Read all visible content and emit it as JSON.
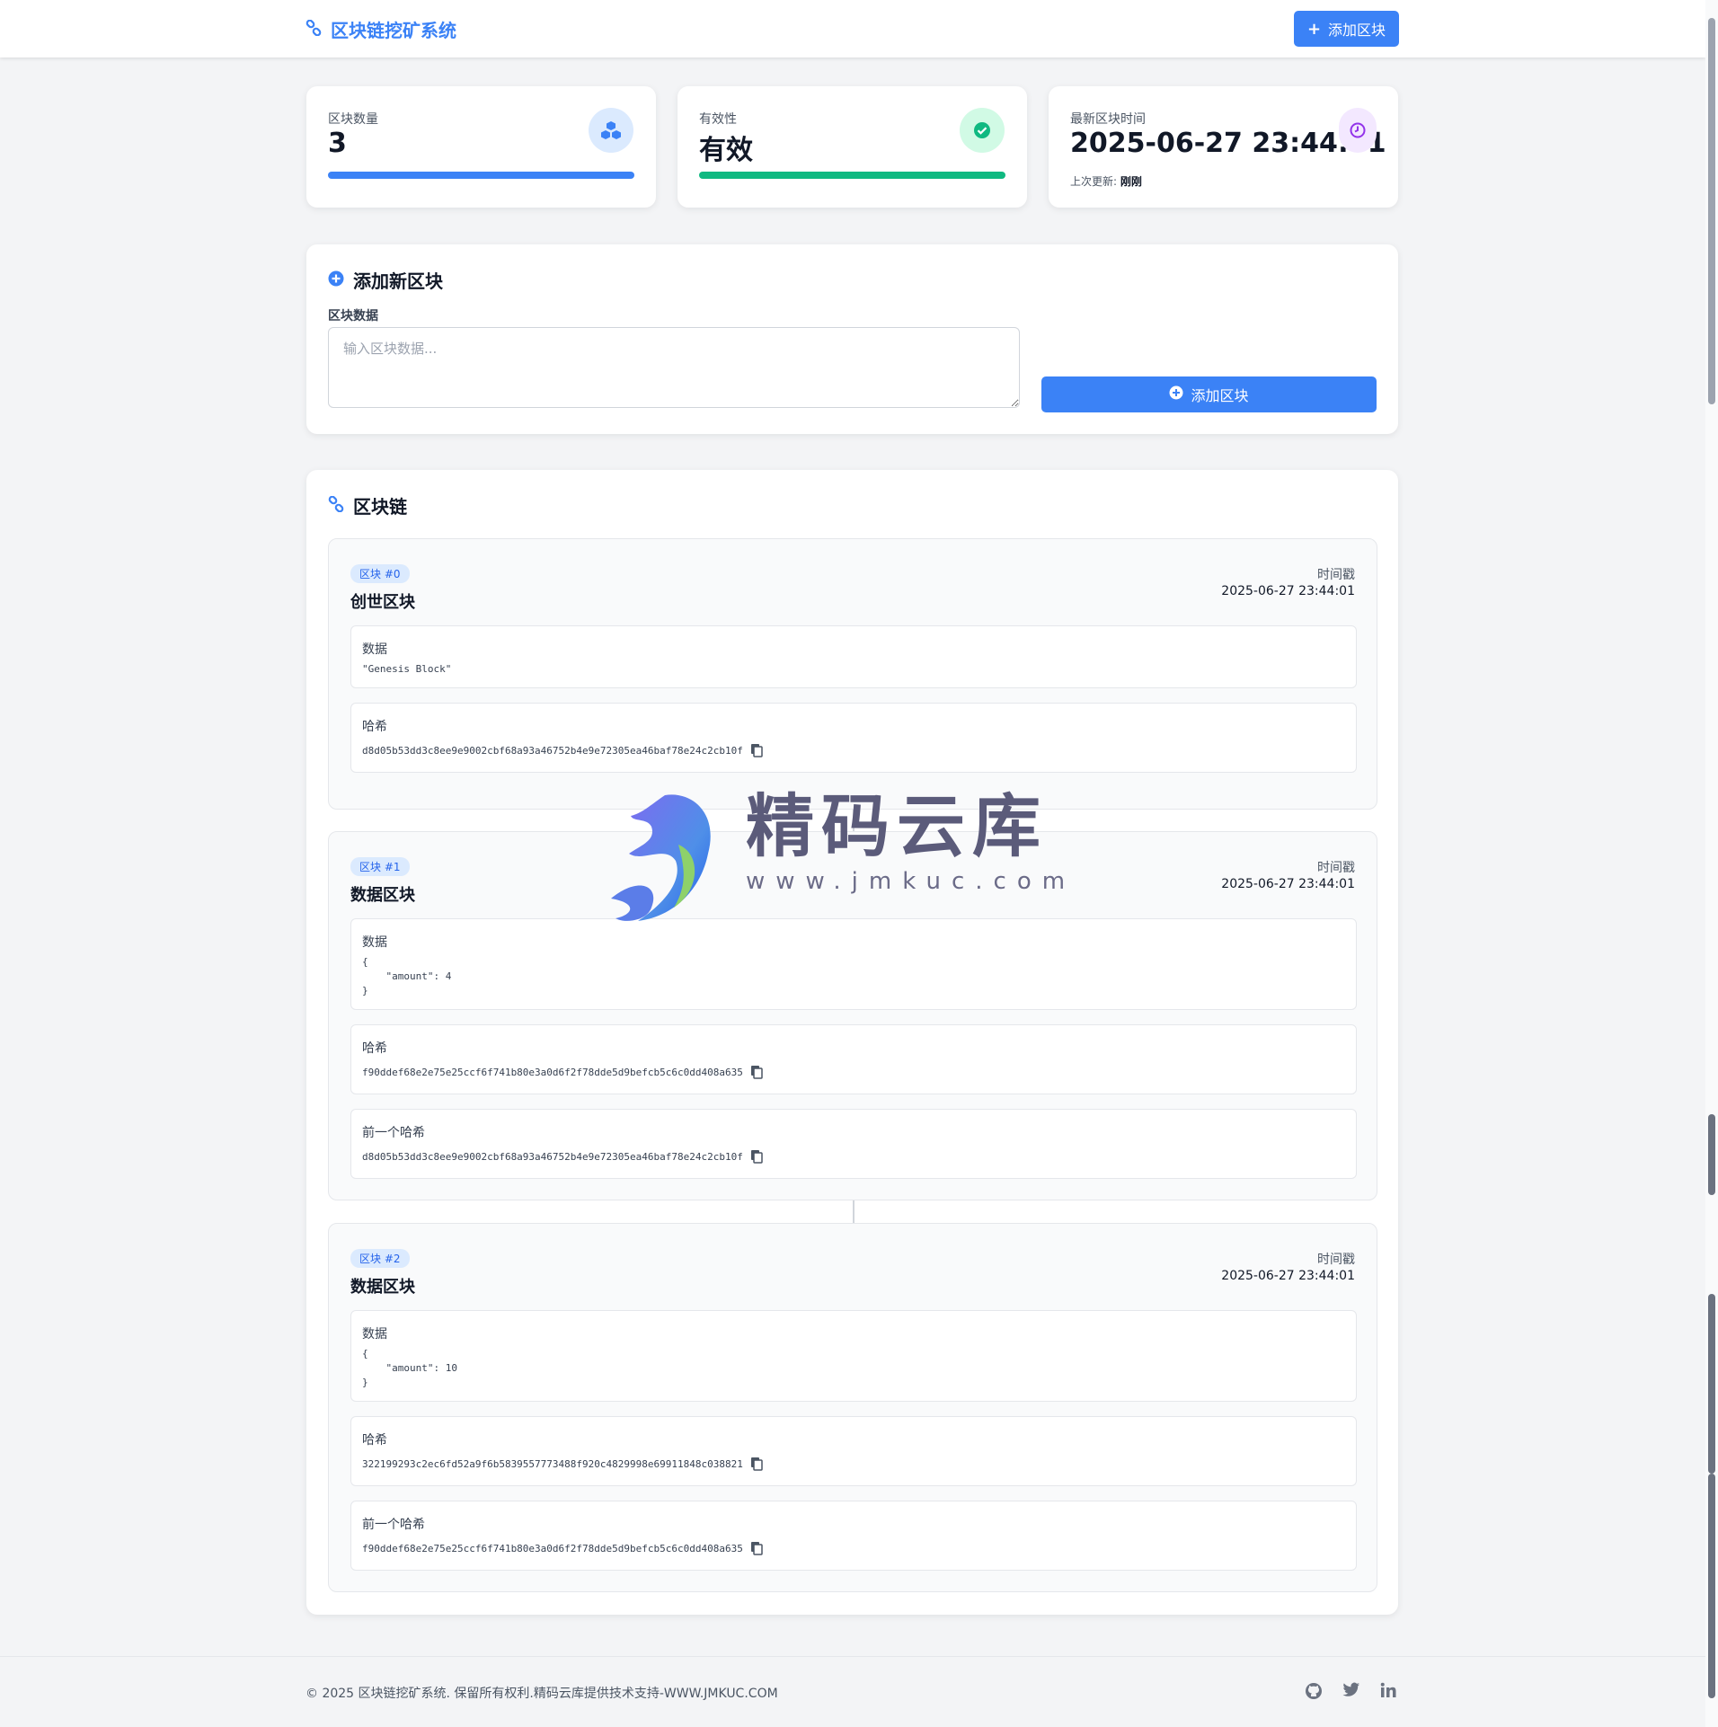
{
  "header": {
    "brand": "区块链挖矿系统",
    "add_button": "添加区块"
  },
  "stats": {
    "count_label": "区块数量",
    "count_value": "3",
    "validity_label": "有效性",
    "validity_value": "有效",
    "latest_label": "最新区块时间",
    "latest_value": "2025-06-27 23:44:01",
    "updated_prefix": "上次更新:",
    "updated_value": "刚刚"
  },
  "add_form": {
    "title": "添加新区块",
    "data_label": "区块数据",
    "placeholder": "输入区块数据...",
    "submit": "添加区块"
  },
  "chain": {
    "title": "区块链",
    "timestamp_label": "时间戳",
    "data_label": "数据",
    "hash_label": "哈希",
    "prev_hash_label": "前一个哈希",
    "blocks": [
      {
        "badge": "区块 #0",
        "title": "创世区块",
        "timestamp": "2025-06-27 23:44:01",
        "data": "\"Genesis Block\"",
        "hash": "d8d05b53dd3c8ee9e9002cbf68a93a46752b4e9e72305ea46baf78e24c2cb10f"
      },
      {
        "badge": "区块 #1",
        "title": "数据区块",
        "timestamp": "2025-06-27 23:44:01",
        "data": "{\n    \"amount\": 4\n}",
        "hash": "f90ddef68e2e75e25ccf6f741b80e3a0d6f2f78dde5d9befcb5c6c0dd408a635",
        "prev_hash": "d8d05b53dd3c8ee9e9002cbf68a93a46752b4e9e72305ea46baf78e24c2cb10f"
      },
      {
        "badge": "区块 #2",
        "title": "数据区块",
        "timestamp": "2025-06-27 23:44:01",
        "data": "{\n    \"amount\": 10\n}",
        "hash": "322199293c2ec6fd52a9f6b5839557773488f920c4829998e69911848c038821",
        "prev_hash": "f90ddef68e2e75e25ccf6f741b80e3a0d6f2f78dde5d9befcb5c6c0dd408a635"
      }
    ]
  },
  "watermark": {
    "text": "精码云库",
    "url": "www.jmkuc.com"
  },
  "footer": {
    "text": "© 2025 区块链挖矿系统. 保留所有权利.精码云库提供技术支持-WWW.JMKUC.COM"
  },
  "colors": {
    "primary": "#3b82f6",
    "success": "#10b981",
    "purple": "#9333ea"
  }
}
